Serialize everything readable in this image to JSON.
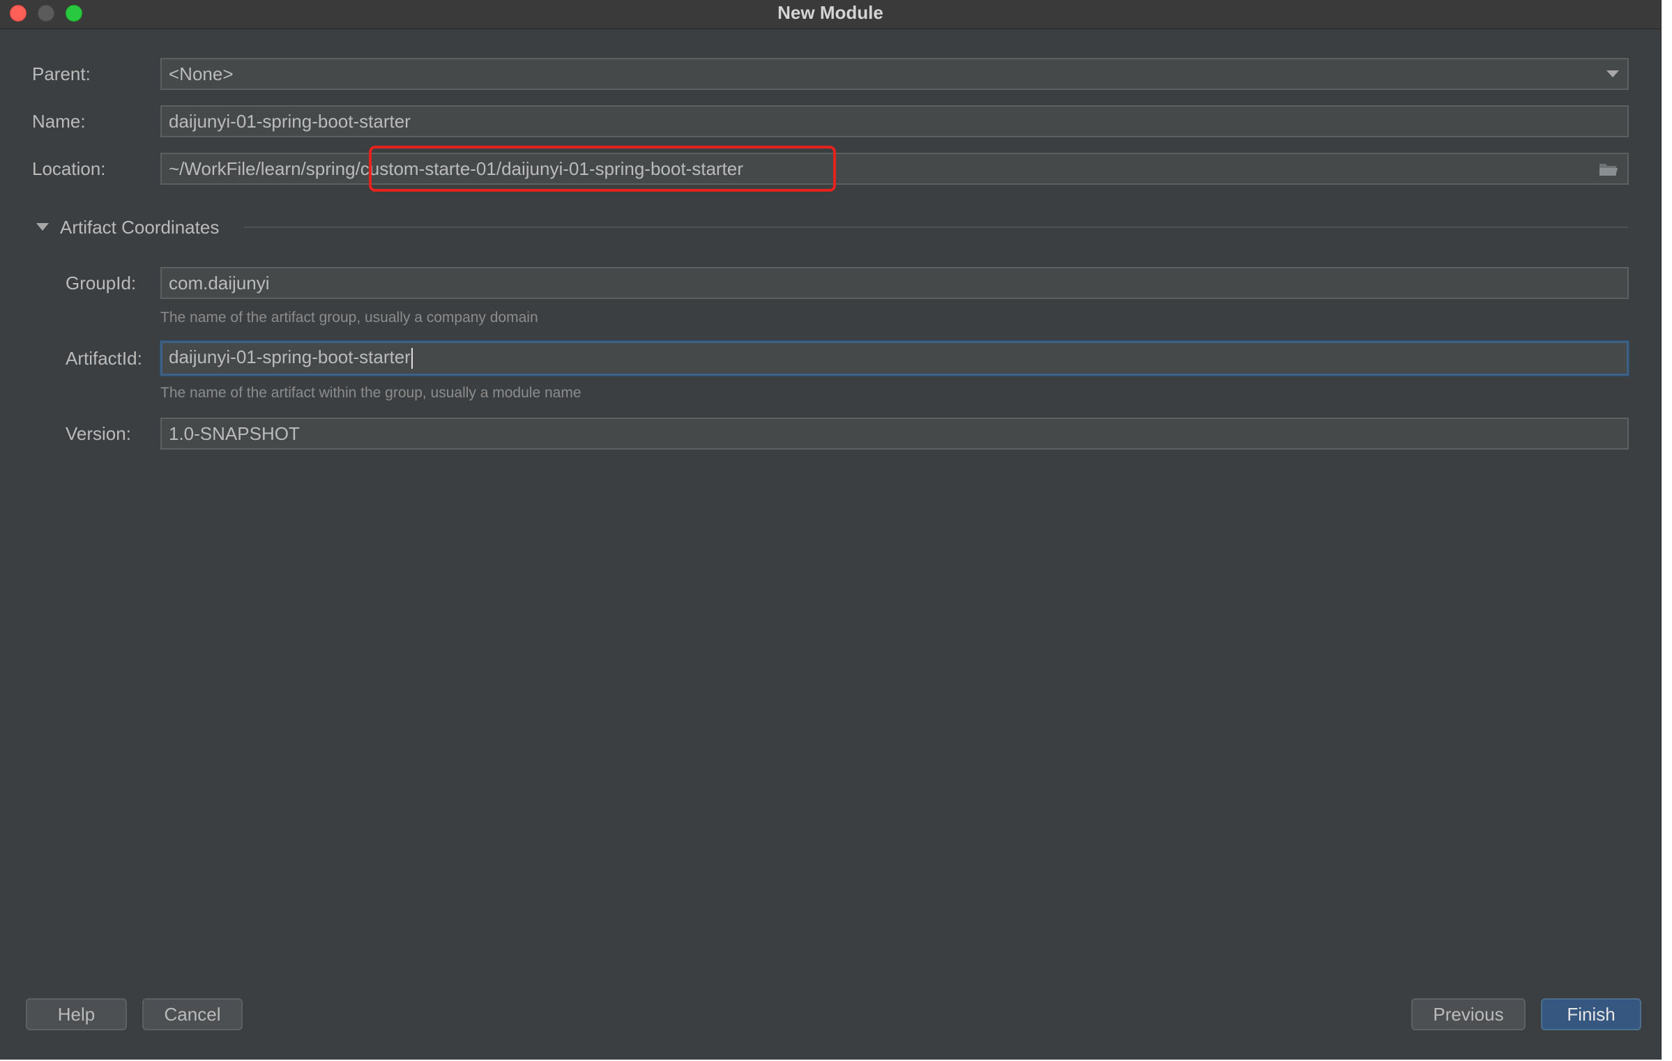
{
  "window": {
    "title": "New Module"
  },
  "form": {
    "parent": {
      "label": "Parent:",
      "value": "<None>"
    },
    "name": {
      "label": "Name:",
      "value": "daijunyi-01-spring-boot-starter"
    },
    "location": {
      "label": "Location:",
      "value": "~/WorkFile/learn/spring/custom-starte-01/daijunyi-01-spring-boot-starter"
    }
  },
  "artifact": {
    "section_title": "Artifact Coordinates",
    "group_id": {
      "label": "GroupId:",
      "value": "com.daijunyi",
      "hint": "The name of the artifact group, usually a company domain"
    },
    "artifact_id": {
      "label": "ArtifactId:",
      "value": "daijunyi-01-spring-boot-starter",
      "hint": "The name of the artifact within the group, usually a module name"
    },
    "version": {
      "label": "Version:",
      "value": "1.0-SNAPSHOT"
    }
  },
  "buttons": {
    "help": "Help",
    "cancel": "Cancel",
    "previous": "Previous",
    "finish": "Finish"
  },
  "colors": {
    "background": "#3c3f41",
    "field_background": "#45494a",
    "primary_button": "#365880",
    "highlight_annotation": "#e4221e",
    "focus_border": "#3d6185"
  },
  "icons": {
    "parent_dropdown": "chevron-down-icon",
    "location_browse": "folder-icon",
    "section_toggle": "triangle-down-icon"
  }
}
